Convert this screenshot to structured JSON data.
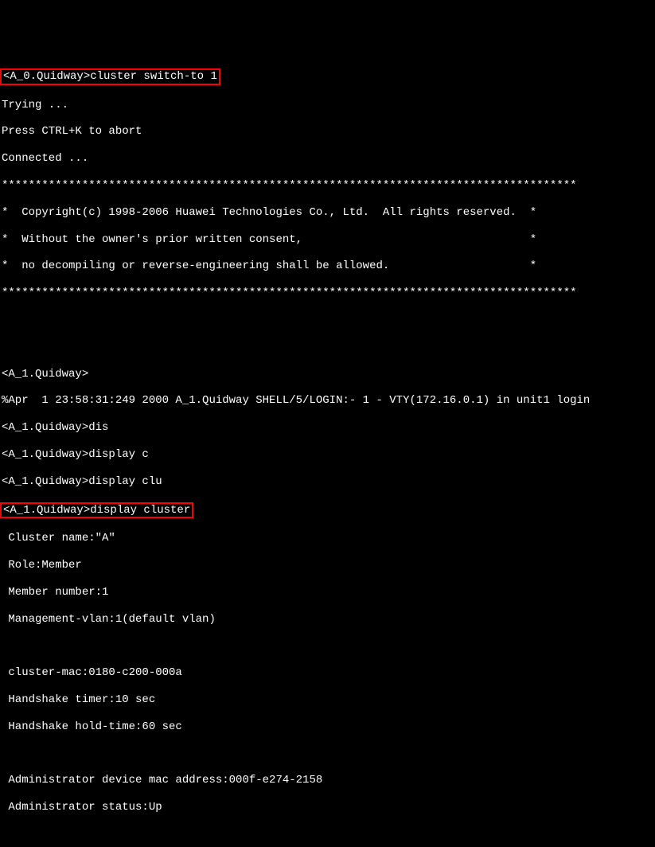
{
  "terminal": {
    "line1_prompt_cmd": "<A_0.Quidway>cluster switch-to 1",
    "line2": "Trying ...",
    "line3": "Press CTRL+K to abort",
    "line4": "Connected ...",
    "line5_stars": "**************************************************************************************",
    "line6": "*  Copyright(c) 1998-2006 Huawei Technologies Co., Ltd.  All rights reserved.  *",
    "line7": "*  Without the owner's prior written consent,                                  *",
    "line8": "*  no decompiling or reverse-engineering shall be allowed.                     *",
    "line9_stars": "**************************************************************************************",
    "line10": "",
    "line11": "",
    "line12": "<A_1.Quidway>",
    "line13": "%Apr  1 23:58:31:249 2000 A_1.Quidway SHELL/5/LOGIN:- 1 - VTY(172.16.0.1) in unit1 login",
    "line14": "<A_1.Quidway>dis",
    "line15": "<A_1.Quidway>display c",
    "line16": "<A_1.Quidway>display clu",
    "line17": "<A_1.Quidway>display cluster",
    "line18": " Cluster name:\"A\"",
    "line19": " Role:Member",
    "line20": " Member number:1",
    "line21": " Management-vlan:1(default vlan)",
    "line22": "",
    "line23": " cluster-mac:0180-c200-000a",
    "line24": " Handshake timer:10 sec",
    "line25": " Handshake hold-time:60 sec",
    "line26": "",
    "line27": " Administrator device mac address:000f-e274-2158",
    "line28": " Administrator status:Up"
  }
}
